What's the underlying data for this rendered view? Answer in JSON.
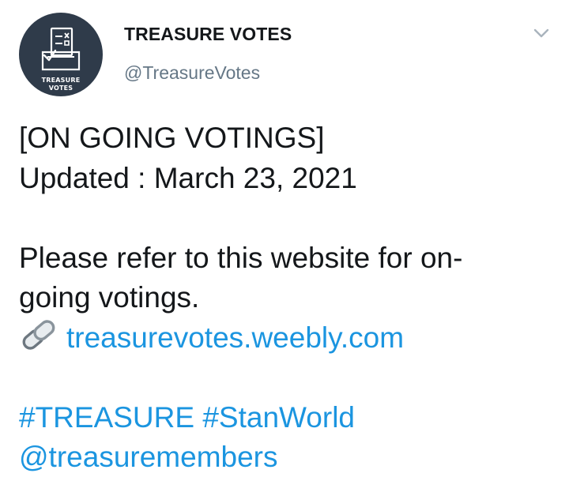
{
  "account": {
    "display_name": "TREASURE VOTES",
    "handle": "@TreasureVotes",
    "avatar_text_line1": "TREASURE",
    "avatar_text_line2": "VOTES"
  },
  "tweet": {
    "line1": "[ON GOING VOTINGS]",
    "line2": "Updated : March 23, 2021",
    "line3": "Please refer to this website for on-",
    "line4": "going votings.",
    "link_icon": "link-icon",
    "link_text": "treasurevotes.weebly.com",
    "hashtags": [
      "#TREASURE",
      "#StanWorld"
    ],
    "mention": "@treasuremembers"
  },
  "menu": {
    "caret_icon": "chevron-down-icon"
  },
  "colors": {
    "link": "#1b95e0",
    "text": "#14171a",
    "secondary": "#657786",
    "avatar_bg": "#2f3b4a"
  }
}
